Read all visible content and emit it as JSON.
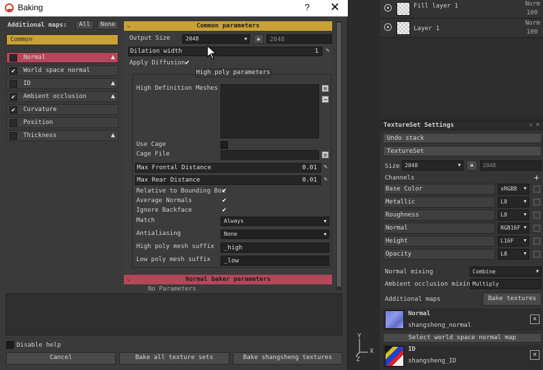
{
  "dialog": {
    "title": "Baking",
    "help_btn": "?",
    "close_btn": "✕",
    "additional_maps_label": "Additional maps:",
    "all_btn": "All",
    "none_btn": "None",
    "common_item": "Common",
    "maps": [
      {
        "label": "Normal",
        "checked": false,
        "warning": true,
        "active": true
      },
      {
        "label": "World space normal",
        "checked": true,
        "warning": false,
        "active": false
      },
      {
        "label": "ID",
        "checked": false,
        "warning": true,
        "active": false
      },
      {
        "label": "Ambient occlusion",
        "checked": true,
        "warning": true,
        "active": false
      },
      {
        "label": "Curvature",
        "checked": true,
        "warning": false,
        "active": false
      },
      {
        "label": "Position",
        "checked": false,
        "warning": false,
        "active": false
      },
      {
        "label": "Thickness",
        "checked": false,
        "warning": true,
        "active": false
      }
    ],
    "common_params_header": "Common parameters",
    "output_size_label": "Output Size",
    "output_size_value": "2048",
    "output_size_locked": "2048",
    "dilation_label": "Dilation width",
    "dilation_value": "1",
    "apply_diffusion_label": "Apply Diffusion",
    "high_poly_header": "High poly parameters",
    "hd_meshes_label": "High Definition Meshes",
    "use_cage_label": "Use Cage",
    "cage_file_label": "Cage File",
    "max_frontal_label": "Max Frontal Distance",
    "max_frontal_value": "0.01",
    "max_rear_label": "Max Rear Distance",
    "max_rear_value": "0.01",
    "relative_bbox_label": "Relative to Bounding Box",
    "avg_normals_label": "Average Normals",
    "ignore_backface_label": "Ignore Backface",
    "match_label": "Match",
    "match_value": "Always",
    "antialiasing_label": "Antialiasing",
    "antialiasing_value": "None",
    "high_suffix_label": "High poly mesh suffix",
    "high_suffix_value": "_high",
    "low_suffix_label": "Low poly mesh suffix",
    "low_suffix_value": "_low",
    "normal_baker_header": "Normal baker parameters",
    "no_parameters_text": "No Parameters",
    "disable_help_label": "Disable help",
    "cancel_btn": "Cancel",
    "bake_all_btn": "Bake all texture sets",
    "bake_one_btn": "Bake shangsheng textures"
  },
  "layers": [
    {
      "name": "Fill layer 1",
      "blend": "Norm",
      "opacity": "100"
    },
    {
      "name": "Layer 1",
      "blend": "Norm",
      "opacity": "100"
    }
  ],
  "texture_set": {
    "title": "TextureSet Settings",
    "undo_stack": "Undo stack",
    "texture_set_btn": "TextureSet",
    "size_label": "Size",
    "size_value": "2048",
    "size_locked": "2048",
    "channels_label": "Channels",
    "channels": [
      {
        "name": "Base Color",
        "format": "sRGB8"
      },
      {
        "name": "Metallic",
        "format": "L8"
      },
      {
        "name": "Roughness",
        "format": "L8"
      },
      {
        "name": "Normal",
        "format": "RGB16F"
      },
      {
        "name": "Height",
        "format": "L16F"
      },
      {
        "name": "Opacity",
        "format": "L8"
      }
    ],
    "normal_mixing_label": "Normal mixing",
    "normal_mixing_value": "Combine",
    "ao_mixing_label": "Ambient occlusion mixing",
    "ao_mixing_value": "Multiply",
    "additional_maps_label": "Additional maps",
    "bake_textures_btn": "Bake textures",
    "maps": [
      {
        "title": "Normal",
        "file": "shangsheng_normal"
      },
      {
        "title": "ID",
        "file": "shangsheng_ID"
      }
    ],
    "select_wsn_btn": "Select world space normal map"
  },
  "axis": {
    "y": "Y",
    "x": "X",
    "z": "Z"
  },
  "colors": {
    "accent_section": "#c9a135",
    "warning_section": "#b5475a"
  }
}
